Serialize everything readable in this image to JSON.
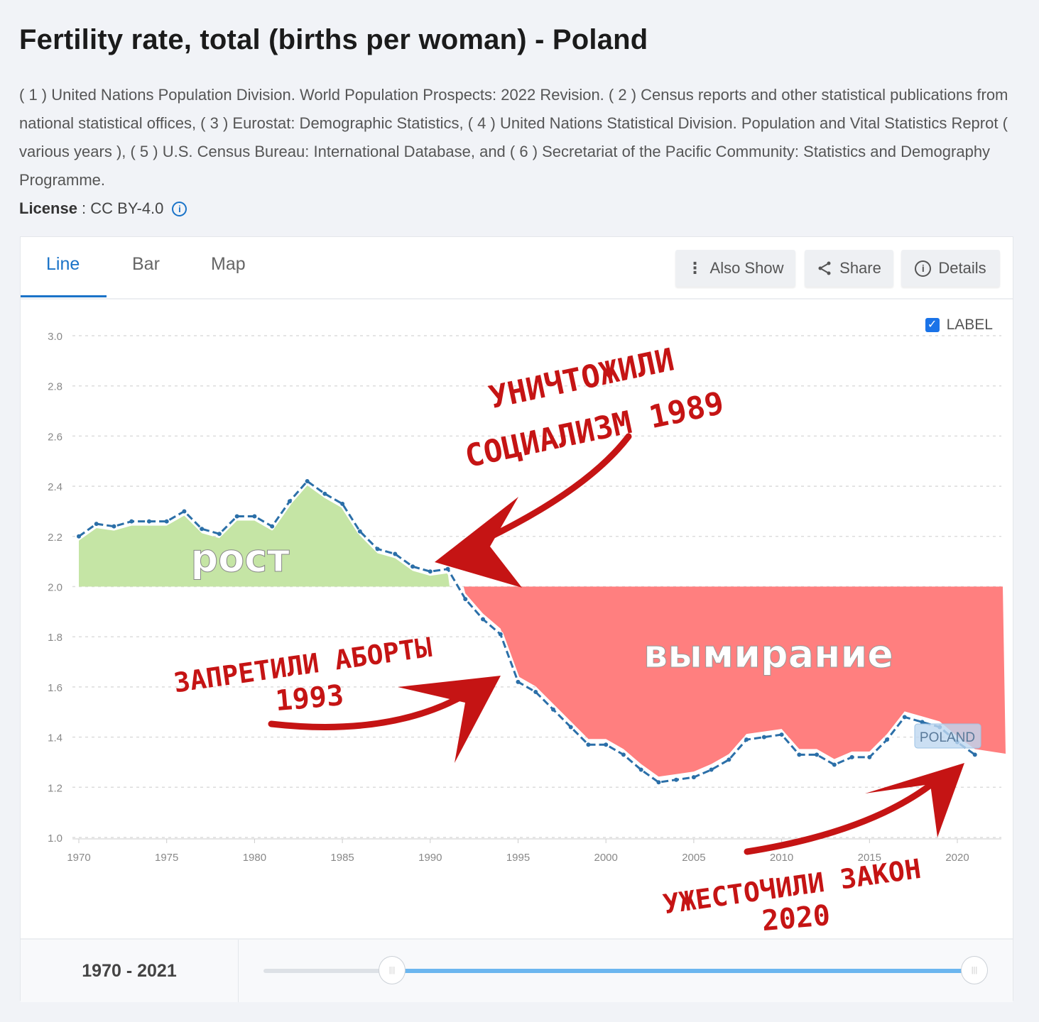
{
  "header": {
    "title": "Fertility rate, total (births per woman) - Poland",
    "source": "( 1 ) United Nations Population Division. World Population Prospects: 2022 Revision. ( 2 ) Census reports and other statistical publications from national statistical offices, ( 3 ) Eurostat: Demographic Statistics, ( 4 ) United Nations Statistical Division. Population and Vital Statistics Reprot ( various years ), ( 5 ) U.S. Census Bureau: International Database, and ( 6 ) Secretariat of the Pacific Community: Statistics and Demography Programme.",
    "license_label": "License",
    "license_value": " : CC BY-4.0",
    "license_icon": "info-icon"
  },
  "tabs": [
    {
      "label": "Line",
      "active": true
    },
    {
      "label": "Bar"
    },
    {
      "label": "Map"
    }
  ],
  "toolbar": {
    "also_show": "Also Show",
    "share": "Share",
    "details": "Details"
  },
  "label_toggle": {
    "label": "LABEL",
    "checked": true
  },
  "footer": {
    "range_start": "1970",
    "range_sep": " - ",
    "range_end": "2021",
    "slider_start_fraction": 0.18,
    "slider_end_fraction": 1.0
  },
  "colors": {
    "accent": "#1a73c8",
    "line": "#2b6fa8",
    "growth_fill": "#c5e5a5",
    "decline_fill": "#ff7f7f",
    "annotation": "#c51414",
    "slider": "#6cb6ef"
  },
  "chart_data": {
    "type": "line",
    "title": "",
    "series": [
      {
        "name": "POLAND",
        "x": [
          1970,
          1971,
          1972,
          1973,
          1974,
          1975,
          1976,
          1977,
          1978,
          1979,
          1980,
          1981,
          1982,
          1983,
          1984,
          1985,
          1986,
          1987,
          1988,
          1989,
          1990,
          1991,
          1992,
          1993,
          1994,
          1995,
          1996,
          1997,
          1998,
          1999,
          2000,
          2001,
          2002,
          2003,
          2004,
          2005,
          2006,
          2007,
          2008,
          2009,
          2010,
          2011,
          2012,
          2013,
          2014,
          2015,
          2016,
          2017,
          2018,
          2019,
          2020,
          2021
        ],
        "values": [
          2.2,
          2.25,
          2.24,
          2.26,
          2.26,
          2.26,
          2.3,
          2.23,
          2.21,
          2.28,
          2.28,
          2.24,
          2.34,
          2.42,
          2.37,
          2.33,
          2.22,
          2.15,
          2.13,
          2.08,
          2.06,
          2.07,
          1.95,
          1.87,
          1.81,
          1.62,
          1.58,
          1.51,
          1.44,
          1.37,
          1.37,
          1.33,
          1.27,
          1.22,
          1.23,
          1.24,
          1.27,
          1.31,
          1.39,
          1.4,
          1.41,
          1.33,
          1.33,
          1.29,
          1.32,
          1.32,
          1.39,
          1.48,
          1.46,
          1.44,
          1.38,
          1.33
        ]
      }
    ],
    "xticks": [
      "1970",
      "1975",
      "1980",
      "1985",
      "1990",
      "1995",
      "2000",
      "2005",
      "2010",
      "2015",
      "2020"
    ],
    "yticks": [
      "1.0",
      "1.2",
      "1.4",
      "1.6",
      "1.8",
      "2.0",
      "2.2",
      "2.4",
      "2.6",
      "2.8",
      "3.0"
    ],
    "xlim": [
      1970,
      2023
    ],
    "ylim": [
      1.0,
      3.0
    ],
    "grid": true,
    "series_label": "POLAND",
    "annotations": {
      "growth": "рост",
      "decline": "вымирание",
      "event_1989_line1": "УНИЧТОЖИЛИ",
      "event_1989_line2": "СОЦИАЛИЗМ 1989",
      "event_1993_line1": "ЗАПРЕТИЛИ АБОРТЫ",
      "event_1993_line2": "1993",
      "event_2020_line1": "УЖЕСТОЧИЛИ ЗАКОН",
      "event_2020_line2": "2020"
    }
  }
}
